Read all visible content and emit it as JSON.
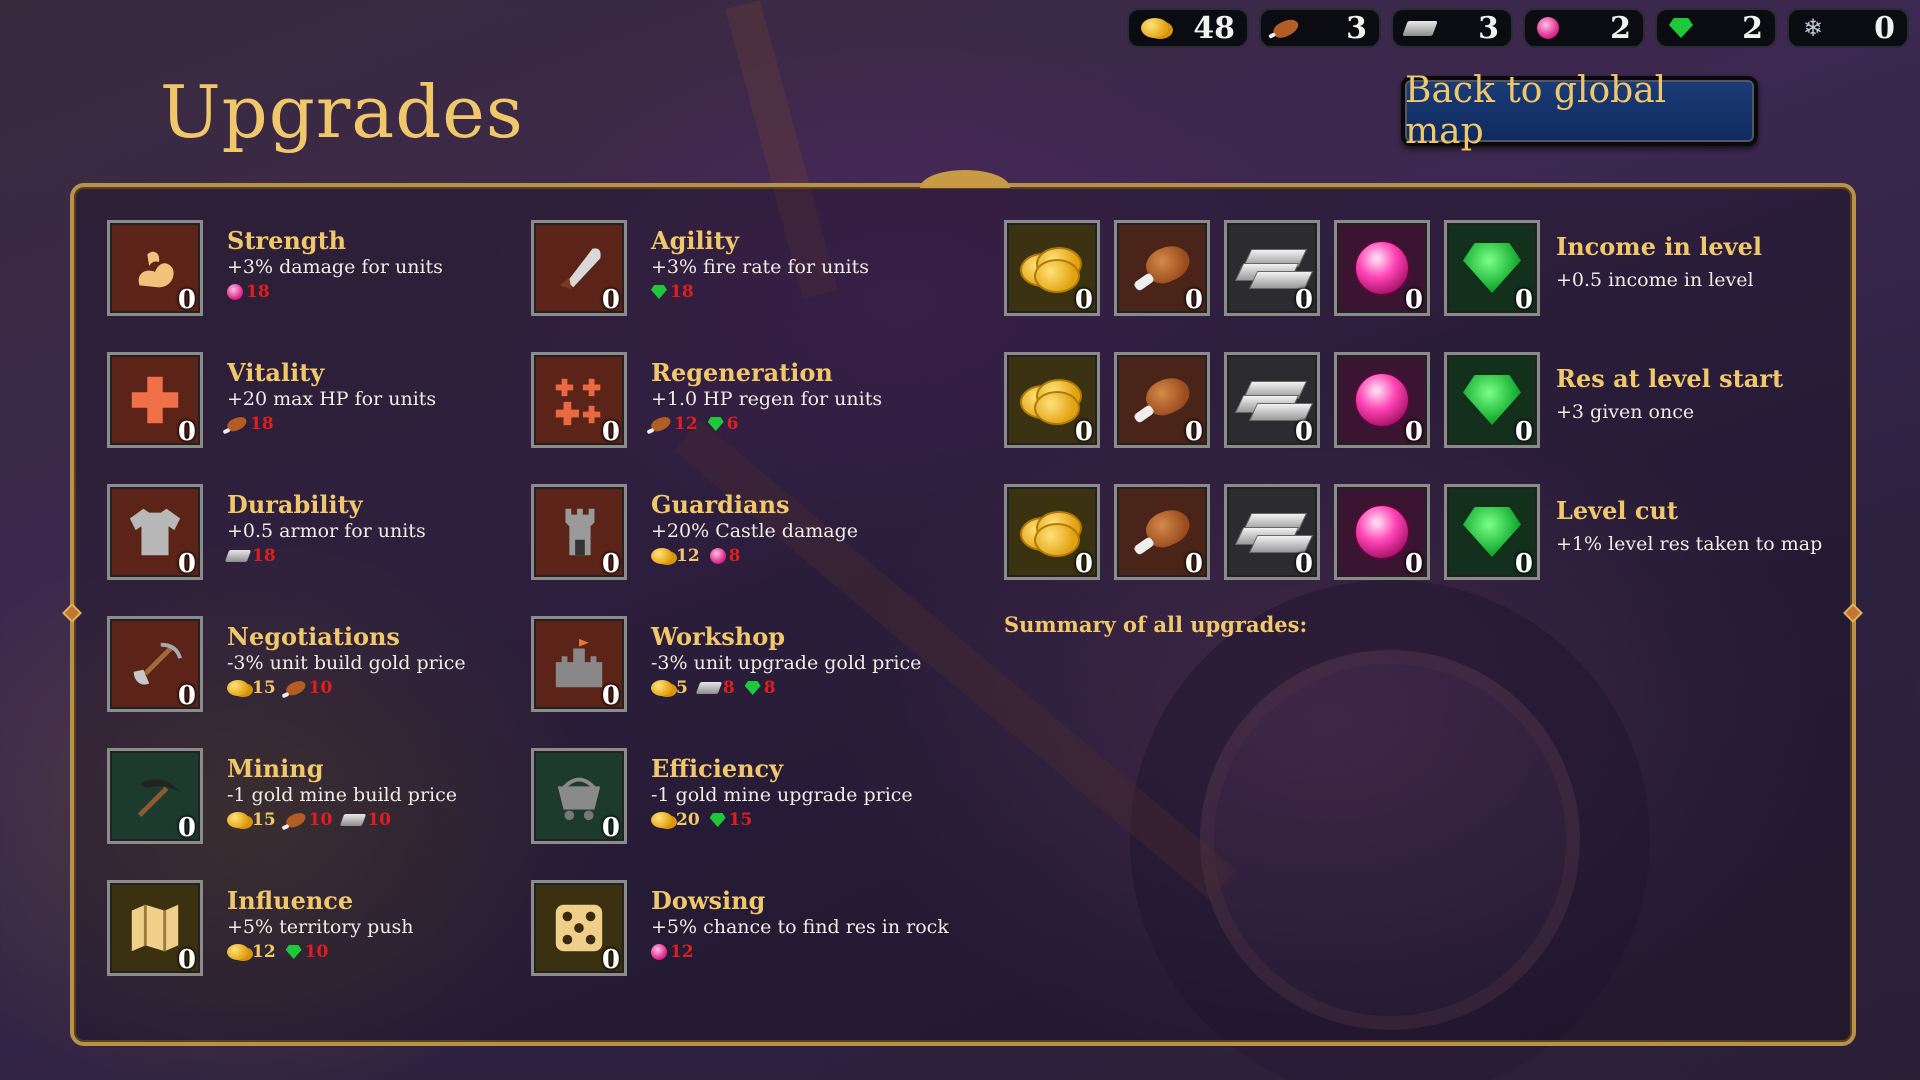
{
  "resources": [
    {
      "icon": "gold-coins-icon",
      "value": "48"
    },
    {
      "icon": "meat-icon",
      "value": "3"
    },
    {
      "icon": "iron-ingot-icon",
      "value": "3"
    },
    {
      "icon": "pearl-icon",
      "value": "2"
    },
    {
      "icon": "emerald-icon",
      "value": "2"
    },
    {
      "icon": "snowflake-icon",
      "value": "0"
    }
  ],
  "title": "Upgrades",
  "back_button": "Back to global map",
  "upgrades": {
    "strength": {
      "name": "Strength",
      "desc": "+3% damage for units",
      "level": "0",
      "icon": "muscle-arm-icon",
      "costs": [
        {
          "res": "pearl",
          "amount": "18"
        }
      ]
    },
    "vitality": {
      "name": "Vitality",
      "desc": "+20 max HP for units",
      "level": "0",
      "icon": "health-cross-icon",
      "costs": [
        {
          "res": "meat",
          "amount": "18"
        }
      ]
    },
    "durability": {
      "name": "Durability",
      "desc": "+0.5 armor for units",
      "level": "0",
      "icon": "armor-shirt-icon",
      "costs": [
        {
          "res": "iron",
          "amount": "18"
        }
      ]
    },
    "negotiations": {
      "name": "Negotiations",
      "desc": "-3% unit build gold price",
      "level": "0",
      "icon": "shovel-pick-icon",
      "costs": [
        {
          "res": "gold",
          "amount": "15"
        },
        {
          "res": "meat",
          "amount": "10"
        }
      ]
    },
    "mining": {
      "name": "Mining",
      "desc": "-1 gold mine build price",
      "level": "0",
      "icon": "pickaxe-icon",
      "costs": [
        {
          "res": "gold",
          "amount": "15"
        },
        {
          "res": "meat",
          "amount": "10"
        },
        {
          "res": "iron",
          "amount": "10"
        }
      ]
    },
    "influence": {
      "name": "Influence",
      "desc": "+5% territory push",
      "level": "0",
      "icon": "map-icon",
      "costs": [
        {
          "res": "gold",
          "amount": "12"
        },
        {
          "res": "emerald",
          "amount": "10"
        }
      ]
    },
    "agility": {
      "name": "Agility",
      "desc": "+3% fire rate for units",
      "level": "0",
      "icon": "sword-icon",
      "costs": [
        {
          "res": "emerald",
          "amount": "18"
        }
      ]
    },
    "regeneration": {
      "name": "Regeneration",
      "desc": "+1.0 HP regen for units",
      "level": "0",
      "icon": "multi-cross-icon",
      "costs": [
        {
          "res": "meat",
          "amount": "12"
        },
        {
          "res": "emerald",
          "amount": "6"
        }
      ]
    },
    "guardians": {
      "name": "Guardians",
      "desc": "+20% Castle damage",
      "level": "0",
      "icon": "tower-icon",
      "costs": [
        {
          "res": "gold",
          "amount": "12"
        },
        {
          "res": "pearl",
          "amount": "8"
        }
      ]
    },
    "workshop": {
      "name": "Workshop",
      "desc": "-3% unit upgrade gold price",
      "level": "0",
      "icon": "castle-icon",
      "costs": [
        {
          "res": "gold",
          "amount": "5"
        },
        {
          "res": "iron",
          "amount": "8"
        },
        {
          "res": "emerald",
          "amount": "8"
        }
      ]
    },
    "efficiency": {
      "name": "Efficiency",
      "desc": "-1 gold mine upgrade price",
      "level": "0",
      "icon": "mine-cart-icon",
      "costs": [
        {
          "res": "gold",
          "amount": "20"
        },
        {
          "res": "emerald",
          "amount": "15"
        }
      ]
    },
    "dowsing": {
      "name": "Dowsing",
      "desc": "+5% chance to find res in rock",
      "level": "0",
      "icon": "dice-icon",
      "costs": [
        {
          "res": "pearl",
          "amount": "12"
        }
      ]
    }
  },
  "resource_upgrades": [
    {
      "name": "Income in level",
      "desc": "+0.5 income in level",
      "levels": [
        "0",
        "0",
        "0",
        "0",
        "0"
      ]
    },
    {
      "name": "Res at level start",
      "desc": "+3 given once",
      "levels": [
        "0",
        "0",
        "0",
        "0",
        "0"
      ]
    },
    {
      "name": "Level cut",
      "desc": "+1% level res taken to map",
      "levels": [
        "0",
        "0",
        "0",
        "0",
        "0"
      ]
    }
  ],
  "summary_label": "Summary of all upgrades:"
}
